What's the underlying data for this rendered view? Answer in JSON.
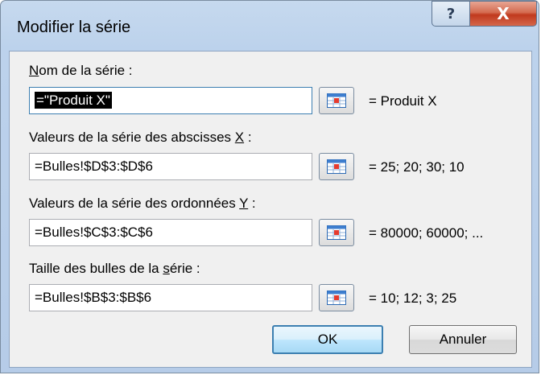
{
  "window": {
    "title": "Modifier la série",
    "help_glyph": "?",
    "close_glyph": "X"
  },
  "fields": [
    {
      "label_before": "",
      "label_accel": "N",
      "label_after": "om de la série :",
      "value": "=\"Produit X\"",
      "preview": "= Produit X",
      "selected": true
    },
    {
      "label_before": "Valeurs de la série des abscisses ",
      "label_accel": "X",
      "label_after": " :",
      "value": "=Bulles!$D$3:$D$6",
      "preview": "= 25; 20; 30; 10",
      "selected": false
    },
    {
      "label_before": "Valeurs de la série des ordonnées ",
      "label_accel": "Y",
      "label_after": " :",
      "value": "=Bulles!$C$3:$C$6",
      "preview": "= 80000; 60000; ...",
      "selected": false
    },
    {
      "label_before": "Taille des bulles de la ",
      "label_accel": "s",
      "label_after": "érie :",
      "value": "=Bulles!$B$3:$B$6",
      "preview": "= 10; 12; 3; 25",
      "selected": false
    }
  ],
  "buttons": {
    "ok": "OK",
    "cancel": "Annuler"
  },
  "colors": {
    "frame": "#bcd2ec",
    "close_red": "#c0391e",
    "dialog_bg": "#f0f0f0",
    "default_button": "#3c7fb1"
  }
}
